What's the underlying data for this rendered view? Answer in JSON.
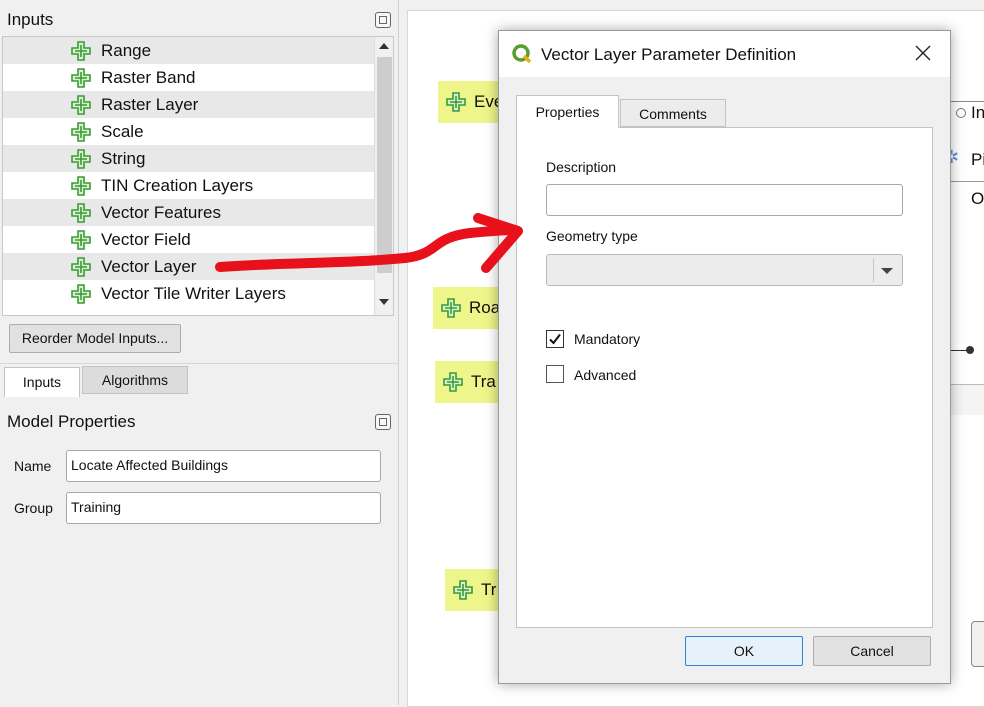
{
  "inputs_panel": {
    "title": "Inputs",
    "items": [
      {
        "label": "Range"
      },
      {
        "label": "Raster Band"
      },
      {
        "label": "Raster Layer"
      },
      {
        "label": "Scale"
      },
      {
        "label": "String"
      },
      {
        "label": "TIN Creation Layers"
      },
      {
        "label": "Vector Features"
      },
      {
        "label": "Vector Field"
      },
      {
        "label": "Vector Layer"
      },
      {
        "label": "Vector Tile Writer Layers"
      }
    ],
    "reorder_button": "Reorder Model Inputs...",
    "tabs": [
      "Inputs",
      "Algorithms"
    ]
  },
  "model_properties": {
    "title": "Model Properties",
    "name_label": "Name",
    "name_value": "Locate Affected Buildings",
    "group_label": "Group",
    "group_value": "Training"
  },
  "canvas": {
    "nodes": [
      "Eve",
      "Roa",
      "Tra",
      "Tr"
    ],
    "right_labels": [
      "In",
      "Pi",
      "O"
    ]
  },
  "dialog": {
    "title": "Vector Layer Parameter Definition",
    "tabs": [
      "Properties",
      "Comments"
    ],
    "description_label": "Description",
    "description_value": "",
    "geometry_label": "Geometry type",
    "geometry_value": "",
    "mandatory_label": "Mandatory",
    "mandatory_checked": true,
    "advanced_label": "Advanced",
    "advanced_checked": false,
    "ok_label": "OK",
    "cancel_label": "Cancel"
  },
  "colors": {
    "node_fill": "#eef58a",
    "plus_icon": "#3a9a3a",
    "annotation_arrow": "#e8101a",
    "qgis_logo": "#5a9e2f"
  }
}
